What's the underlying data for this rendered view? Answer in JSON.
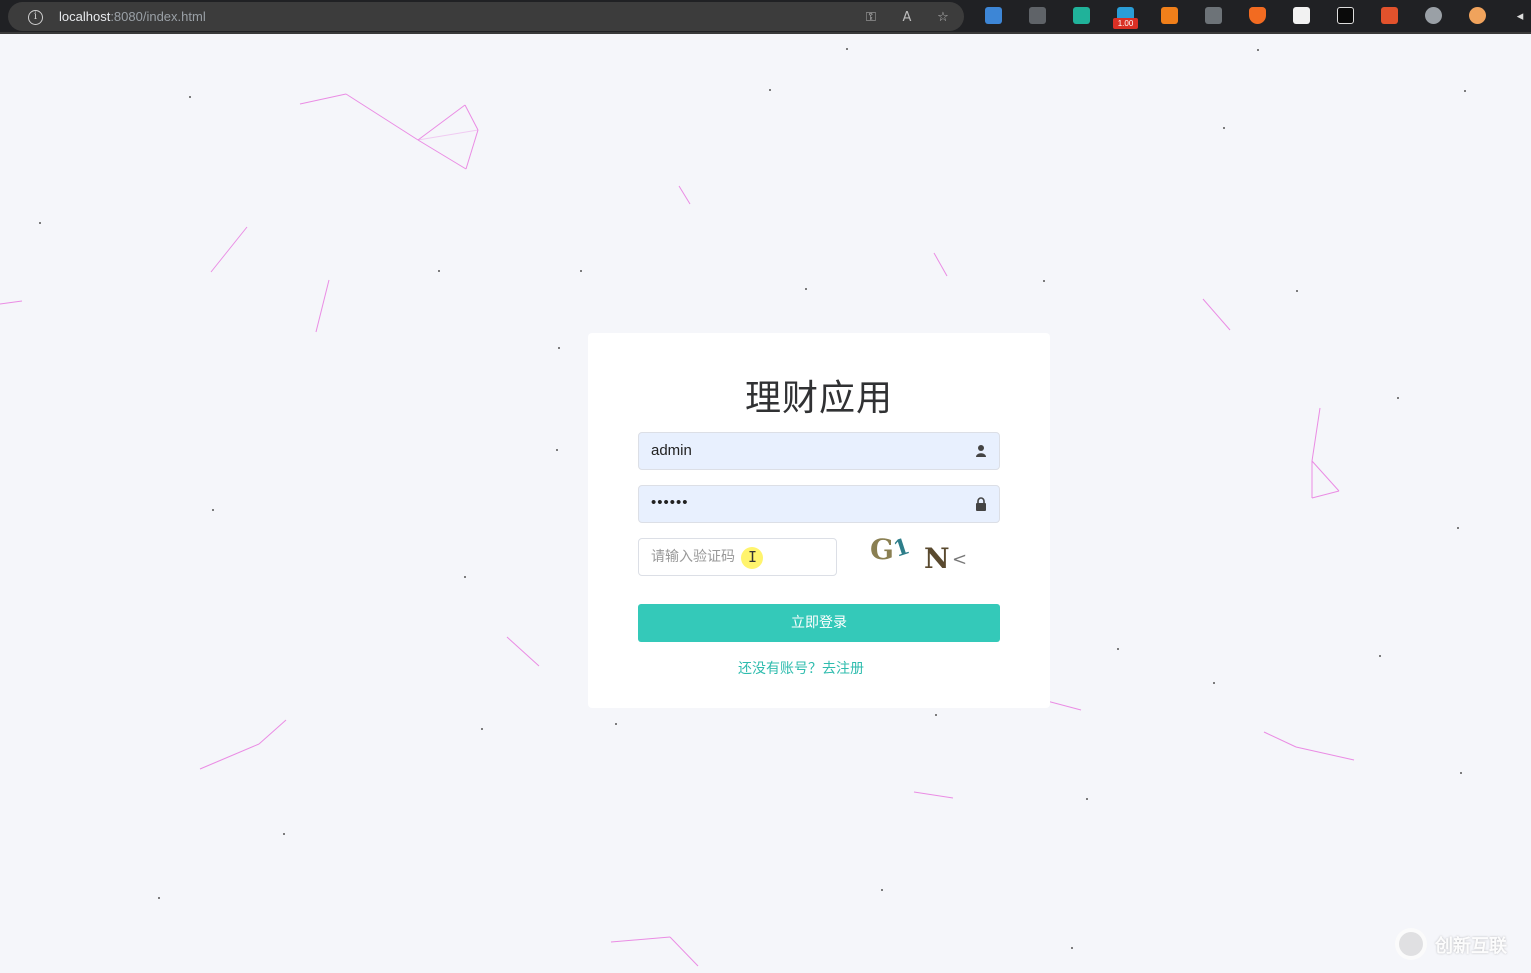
{
  "browser": {
    "url_host": "localhost",
    "url_path": ":8080/index.html",
    "extension_badge": "1.00"
  },
  "login": {
    "title": "理财应用",
    "username_value": "admin",
    "password_value": "••••••",
    "captcha_placeholder": "请输入验证码",
    "captcha_chars": [
      "G",
      "1",
      "N",
      "<"
    ],
    "submit_label": "立即登录",
    "register_link": "还没有账号？去注册"
  },
  "watermark": {
    "text": "创新互联"
  },
  "colors": {
    "accent": "#34c9b9",
    "link": "#2fbcae",
    "particle_line": "#e879e0",
    "background": "#f5f6fa"
  },
  "icons": {
    "username": "user-icon",
    "password": "lock-icon",
    "address_bar": "info-icon"
  }
}
